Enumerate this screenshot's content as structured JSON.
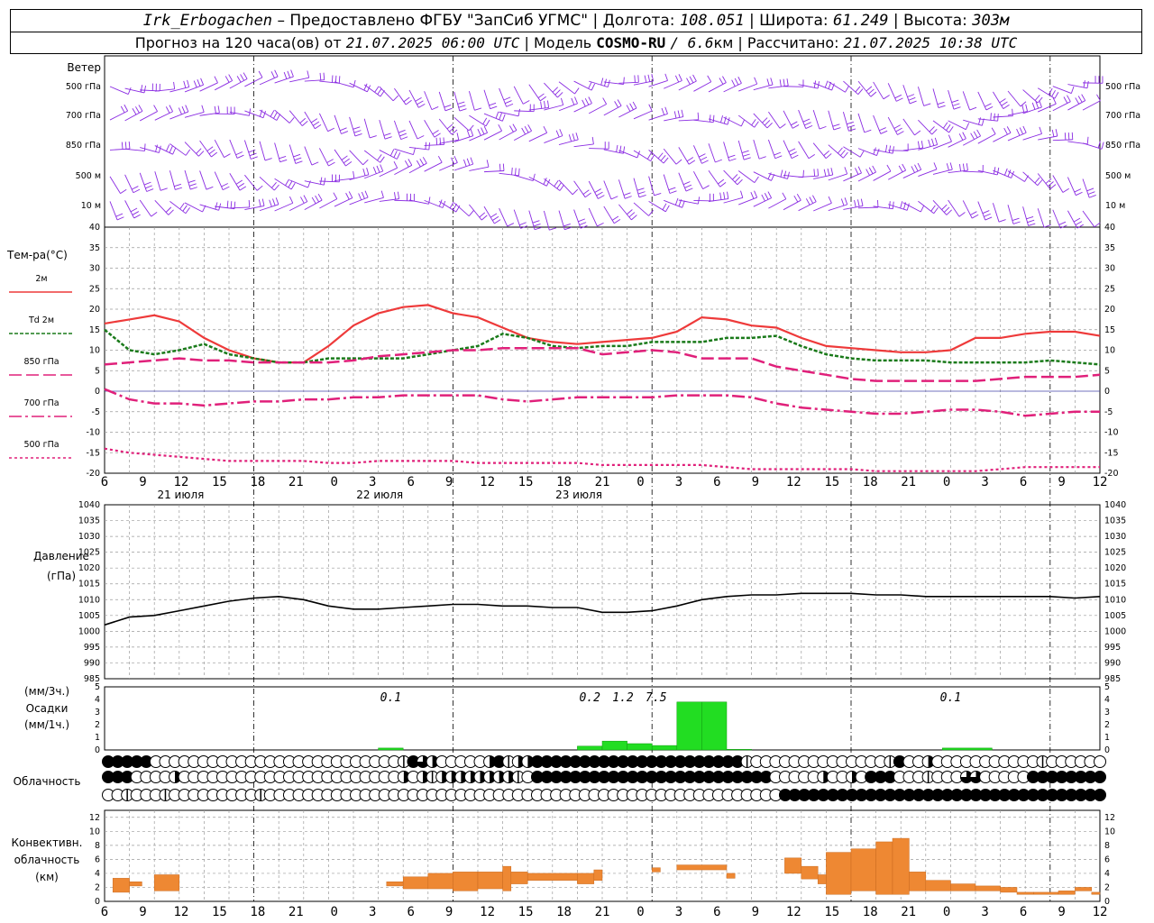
{
  "header": {
    "station": "Irk_Erbogachen",
    "provider": "– Предоставлено ФГБУ \"ЗапСиб УГМС\"",
    "lon_label": "Долгота:",
    "lon": "108.051",
    "lat_label": "Широта:",
    "lat": "61.249",
    "alt_label": "Высота:",
    "alt": "303м",
    "forecast_prefix": "Прогноз на 120 часа(ов) от",
    "forecast_start": "21.07.2025 06:00 UTC",
    "model_label": "Модель",
    "model": "COSMO-RU",
    "resolution": "/ 6.6",
    "resolution_unit": "км",
    "computed_label": "Рассчитано:",
    "computed": "21.07.2025 10:38 UTC"
  },
  "labels": {
    "wind": "Ветер",
    "wind_levels": [
      "500 гПа",
      "700 гПа",
      "850 гПа",
      "500 м",
      "10  м"
    ],
    "temp_title": "Тем-ра(°С)",
    "temp_legend": [
      "2м",
      "Td 2м",
      "850 гПа",
      "700 гПа",
      "500 гПа"
    ],
    "pressure_title": "Давление",
    "pressure_unit": "(гПа)",
    "precip_l1": "(мм/3ч.)",
    "precip_l2": "Осадки",
    "precip_l3": "(мм/1ч.)",
    "cloud": "Облачность",
    "conv_l1": "Конвективн.",
    "conv_l2": "облачность",
    "conv_l3": "(км)"
  },
  "colors": {
    "wind": "#8a2be2",
    "t2m": "#ee3a3a",
    "td2m": "#1a7a1a",
    "t850": "#e0207a",
    "t700": "#e0207a",
    "t500": "#e0207a",
    "pressure": "#000000",
    "precip": "#22dd22",
    "conv": "#ee8833"
  },
  "chart_data": [
    {
      "type": "line",
      "name": "temperature",
      "x_hours": [
        0,
        3,
        6,
        9,
        12,
        15,
        18,
        21,
        24,
        27,
        30,
        33,
        36,
        39,
        42,
        45,
        48,
        51,
        54,
        57,
        60,
        63,
        66,
        69,
        72,
        75,
        78,
        81,
        84,
        87,
        90,
        93,
        96,
        99,
        102,
        105,
        108,
        111,
        114,
        117,
        120
      ],
      "x_tick_labels": [
        "6",
        "9",
        "12",
        "15",
        "18",
        "21",
        "0",
        "3",
        "6",
        "9",
        "12",
        "15",
        "18",
        "21",
        "0",
        "3",
        "6",
        "9",
        "12",
        "15",
        "18",
        "21",
        "0",
        "3",
        "6",
        "9",
        "12"
      ],
      "date_labels": [
        "21 июля",
        "22 июля",
        "23 июля"
      ],
      "ylim": [
        -20,
        40
      ],
      "yticks": [
        40,
        35,
        30,
        25,
        20,
        15,
        10,
        5,
        0,
        -5,
        -10,
        -15,
        -20
      ],
      "series": [
        {
          "name": "2м",
          "values": [
            16.5,
            17.5,
            18.5,
            17,
            13,
            10,
            8,
            7,
            7,
            11,
            16,
            19,
            20.5,
            21,
            19,
            18,
            15.5,
            13,
            12,
            11.5,
            12,
            12.5,
            13,
            14.5,
            18,
            17.5,
            16,
            15.5,
            13,
            11,
            10.5,
            10,
            9.5,
            9.5,
            10,
            13,
            13,
            14,
            14.5,
            14.5,
            13.5
          ]
        },
        {
          "name": "Td 2м",
          "values": [
            15,
            10,
            9,
            10,
            11.5,
            9,
            8,
            7,
            7,
            8,
            8,
            8,
            8,
            9,
            10,
            11,
            14,
            13,
            11,
            10.5,
            11,
            11,
            12,
            12,
            12,
            13,
            13,
            13.5,
            11,
            9,
            8,
            7.5,
            7.5,
            7.5,
            7,
            7,
            7,
            7,
            7.5,
            7,
            6.5
          ]
        },
        {
          "name": "850 гПа",
          "values": [
            6.5,
            7,
            7.5,
            8,
            7.5,
            7.5,
            7,
            7,
            7,
            7,
            7.5,
            8.5,
            9,
            9.5,
            10,
            10,
            10.5,
            10.5,
            10.5,
            10.5,
            9,
            9.5,
            10,
            9.5,
            8,
            8,
            8,
            6,
            5,
            4,
            3,
            2.5,
            2.5,
            2.5,
            2.5,
            2.5,
            3,
            3.5,
            3.5,
            3.5,
            4
          ]
        },
        {
          "name": "700 гПа",
          "values": [
            0.5,
            -2,
            -3,
            -3,
            -3.5,
            -3,
            -2.5,
            -2.5,
            -2,
            -2,
            -1.5,
            -1.5,
            -1,
            -1,
            -1,
            -1,
            -2,
            -2.5,
            -2,
            -1.5,
            -1.5,
            -1.5,
            -1.5,
            -1,
            -1,
            -1,
            -1.5,
            -3,
            -4,
            -4.5,
            -5,
            -5.5,
            -5.5,
            -5,
            -4.5,
            -4.5,
            -5,
            -6,
            -5.5,
            -5,
            -5
          ]
        },
        {
          "name": "500 гПа",
          "values": [
            -14,
            -15,
            -15.5,
            -16,
            -16.5,
            -17,
            -17,
            -17,
            -17,
            -17.5,
            -17.5,
            -17,
            -17,
            -17,
            -17,
            -17.5,
            -17.5,
            -17.5,
            -17.5,
            -17.5,
            -18,
            -18,
            -18,
            -18,
            -18,
            -18.5,
            -19,
            -19,
            -19,
            -19,
            -19,
            -19.5,
            -19.5,
            -19.5,
            -19.5,
            -19.5,
            -19,
            -18.5,
            -18.5,
            -18.5,
            -18.5
          ]
        }
      ]
    },
    {
      "type": "line",
      "name": "pressure",
      "x_hours": [
        0,
        3,
        6,
        9,
        12,
        15,
        18,
        21,
        24,
        27,
        30,
        33,
        36,
        39,
        42,
        45,
        48,
        51,
        54,
        57,
        60,
        63,
        66,
        69,
        72,
        75,
        78,
        81,
        84,
        87,
        90,
        93,
        96,
        99,
        102,
        105,
        108,
        111,
        114,
        117,
        120
      ],
      "ylim": [
        985,
        1040
      ],
      "yticks": [
        1040,
        1035,
        1030,
        1025,
        1020,
        1015,
        1010,
        1005,
        1000,
        995,
        990,
        985
      ],
      "values": [
        1002,
        1004.5,
        1005,
        1006.5,
        1008,
        1009.5,
        1010.5,
        1011,
        1010,
        1008,
        1007,
        1007,
        1007.5,
        1008,
        1008.5,
        1008.5,
        1008,
        1008,
        1007.5,
        1007.5,
        1006,
        1006,
        1006.5,
        1008,
        1010,
        1011,
        1011.5,
        1011.5,
        1012,
        1012,
        1012,
        1011.5,
        1011.5,
        1011,
        1011,
        1011,
        1011,
        1011,
        1011,
        1010.5,
        1011
      ]
    },
    {
      "type": "bar",
      "name": "precipitation",
      "ylim": [
        0,
        5
      ],
      "yticks": [
        5,
        4,
        3,
        2,
        1,
        0
      ],
      "bars": [
        {
          "h": 33,
          "w": 3,
          "v": 0.15
        },
        {
          "h": 57,
          "w": 3,
          "v": 0.3
        },
        {
          "h": 60,
          "w": 3,
          "v": 0.7
        },
        {
          "h": 63,
          "w": 3,
          "v": 0.5
        },
        {
          "h": 66,
          "w": 3,
          "v": 0.35
        },
        {
          "h": 69,
          "w": 3,
          "v": 3.8
        },
        {
          "h": 72,
          "w": 3,
          "v": 3.8
        },
        {
          "h": 75,
          "w": 3,
          "v": 0.05
        },
        {
          "h": 101,
          "w": 6,
          "v": 0.15
        }
      ],
      "annotations": [
        {
          "h": 34.5,
          "text": "0.1"
        },
        {
          "h": 58.5,
          "text": "0.2"
        },
        {
          "h": 62.5,
          "text": "1.2"
        },
        {
          "h": 66.5,
          "text": "7.5"
        },
        {
          "h": 102,
          "text": "0.1"
        }
      ]
    },
    {
      "type": "table",
      "name": "cloudiness",
      "rows": [
        "444440000000000000000000000000014320000024122444444444444444444444410000000000000014002000000000001000000",
        "444000020000000000000000000000020212222222210444444444444444444444444400000200204440001000330000044444444444321000",
        "00100010000000001000000000000000000000000000000000000000000000000000000444444444444444444444444444444444444414234444"
      ]
    },
    {
      "type": "bar",
      "name": "convective_cloud",
      "ylim": [
        0,
        13
      ],
      "yticks": [
        12,
        10,
        8,
        6,
        4,
        2,
        0
      ],
      "bars": [
        {
          "h0": 1,
          "h1": 3,
          "b": 1.3,
          "t": 3.3
        },
        {
          "h0": 3,
          "h1": 4.5,
          "b": 2.2,
          "t": 2.8
        },
        {
          "h0": 6,
          "h1": 9,
          "b": 1.5,
          "t": 3.8
        },
        {
          "h0": 34,
          "h1": 36,
          "b": 2.2,
          "t": 2.8
        },
        {
          "h0": 36,
          "h1": 39,
          "b": 1.8,
          "t": 3.5
        },
        {
          "h0": 39,
          "h1": 42,
          "b": 1.8,
          "t": 4.0
        },
        {
          "h0": 42,
          "h1": 45,
          "b": 1.5,
          "t": 4.2
        },
        {
          "h0": 45,
          "h1": 48,
          "b": 1.8,
          "t": 4.2
        },
        {
          "h0": 48,
          "h1": 49,
          "b": 1.5,
          "t": 5.0
        },
        {
          "h0": 49,
          "h1": 51,
          "b": 2.5,
          "t": 4.2
        },
        {
          "h0": 51,
          "h1": 57,
          "b": 3.0,
          "t": 4.0
        },
        {
          "h0": 57,
          "h1": 59,
          "b": 2.5,
          "t": 4.0
        },
        {
          "h0": 59,
          "h1": 60,
          "b": 3.0,
          "t": 4.5
        },
        {
          "h0": 66,
          "h1": 67,
          "b": 4.2,
          "t": 4.8
        },
        {
          "h0": 69,
          "h1": 75,
          "b": 4.5,
          "t": 5.2
        },
        {
          "h0": 75,
          "h1": 76,
          "b": 3.3,
          "t": 4.0
        },
        {
          "h0": 82,
          "h1": 84,
          "b": 4.0,
          "t": 6.2
        },
        {
          "h0": 84,
          "h1": 86,
          "b": 3.2,
          "t": 5.0
        },
        {
          "h0": 86,
          "h1": 87,
          "b": 2.5,
          "t": 3.8
        },
        {
          "h0": 87,
          "h1": 90,
          "b": 1.0,
          "t": 7.0
        },
        {
          "h0": 90,
          "h1": 93,
          "b": 1.5,
          "t": 7.5
        },
        {
          "h0": 93,
          "h1": 95,
          "b": 1.0,
          "t": 8.5
        },
        {
          "h0": 95,
          "h1": 97,
          "b": 1.0,
          "t": 9.0
        },
        {
          "h0": 97,
          "h1": 99,
          "b": 1.5,
          "t": 4.2
        },
        {
          "h0": 99,
          "h1": 102,
          "b": 1.5,
          "t": 3.0
        },
        {
          "h0": 102,
          "h1": 105,
          "b": 1.5,
          "t": 2.5
        },
        {
          "h0": 105,
          "h1": 108,
          "b": 1.5,
          "t": 2.2
        },
        {
          "h0": 108,
          "h1": 110,
          "b": 1.3,
          "t": 2.0
        },
        {
          "h0": 110,
          "h1": 112,
          "b": 1.0,
          "t": 1.3
        },
        {
          "h0": 112,
          "h1": 115,
          "b": 1.0,
          "t": 1.3
        },
        {
          "h0": 115,
          "h1": 117,
          "b": 1.0,
          "t": 1.5
        },
        {
          "h0": 117,
          "h1": 119,
          "b": 1.5,
          "t": 2.0
        },
        {
          "h0": 119,
          "h1": 120,
          "b": 1.0,
          "t": 1.3
        }
      ]
    }
  ]
}
